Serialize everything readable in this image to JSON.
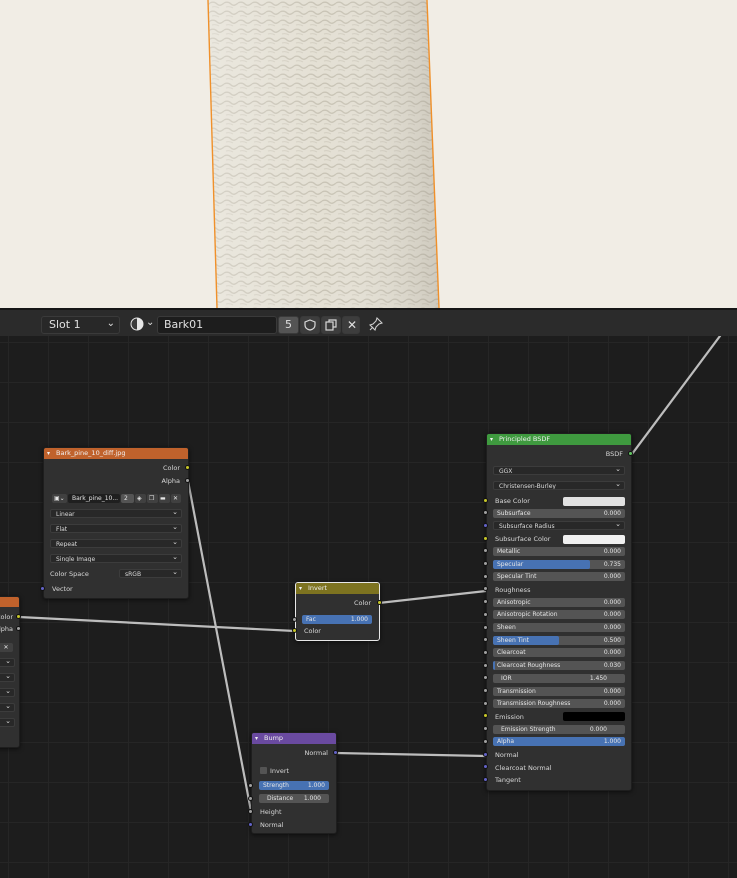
{
  "toolbar": {
    "slot": "Slot 1",
    "material_name": "Bark01",
    "user_count": "5"
  },
  "image_node": {
    "title": "Bark_pine_10_diff.jpg",
    "outputs": [
      "Color",
      "Alpha"
    ],
    "image_name": "Bark_pine_10...",
    "image_users": "2",
    "interpolation": "Linear",
    "projection": "Flat",
    "extension": "Repeat",
    "source": "Single Image",
    "color_space_label": "Color Space",
    "color_space": "sRGB",
    "vector_label": "Vector",
    "header_color": "#c0622c"
  },
  "partial_node": {
    "outputs": [
      "Color",
      "Alpha"
    ]
  },
  "invert_node": {
    "title": "Invert",
    "output": "Color",
    "fac_label": "Fac",
    "fac_value": "1.000",
    "fac_fraction": 1.0,
    "color_label": "Color",
    "header_color": "#7d7320"
  },
  "bump_node": {
    "title": "Bump",
    "output": "Normal",
    "invert_label": "Invert",
    "strength_label": "Strength",
    "strength_value": "1.000",
    "strength_fraction": 1.0,
    "distance_label": "Distance",
    "distance_value": "1.000",
    "height_label": "Height",
    "normal_label": "Normal",
    "header_color": "#6a4aa0"
  },
  "bsdf_node": {
    "title": "Principled BSDF",
    "output": "BSDF",
    "distribution": "GGX",
    "subsurface_method": "Christensen-Burley",
    "header_color": "#3f9a3f",
    "inputs": [
      {
        "label": "Base Color",
        "type": "color",
        "color": "#e2e2e2",
        "socket": "y"
      },
      {
        "label": "Subsurface",
        "value": "0.000",
        "fraction": 0,
        "socket": "g"
      },
      {
        "label": "Subsurface Radius",
        "type": "dropdown",
        "socket": "b"
      },
      {
        "label": "Subsurface Color",
        "type": "color",
        "color": "#f0f0f0",
        "socket": "y"
      },
      {
        "label": "Metallic",
        "value": "0.000",
        "fraction": 0,
        "socket": "g"
      },
      {
        "label": "Specular",
        "value": "0.735",
        "fraction": 0.735,
        "socket": "g"
      },
      {
        "label": "Specular Tint",
        "value": "0.000",
        "fraction": 0,
        "socket": "g"
      },
      {
        "label": "Roughness",
        "type": "plain",
        "socket": "g"
      },
      {
        "label": "Anisotropic",
        "value": "0.000",
        "fraction": 0,
        "socket": "g"
      },
      {
        "label": "Anisotropic Rotation",
        "value": "0.000",
        "fraction": 0,
        "socket": "g"
      },
      {
        "label": "Sheen",
        "value": "0.000",
        "fraction": 0,
        "socket": "g"
      },
      {
        "label": "Sheen Tint",
        "value": "0.500",
        "fraction": 0.5,
        "socket": "g"
      },
      {
        "label": "Clearcoat",
        "value": "0.000",
        "fraction": 0,
        "socket": "g"
      },
      {
        "label": "Clearcoat Roughness",
        "value": "0.030",
        "fraction": 0.03,
        "socket": "g"
      },
      {
        "label": "IOR",
        "value": "1.450",
        "type": "center",
        "socket": "g"
      },
      {
        "label": "Transmission",
        "value": "0.000",
        "fraction": 0,
        "socket": "g"
      },
      {
        "label": "Transmission Roughness",
        "value": "0.000",
        "fraction": 0,
        "socket": "g"
      },
      {
        "label": "Emission",
        "type": "color",
        "color": "#000000",
        "socket": "y"
      },
      {
        "label": "Emission Strength",
        "value": "0.000",
        "type": "center",
        "socket": "g"
      },
      {
        "label": "Alpha",
        "value": "1.000",
        "fraction": 1.0,
        "socket": "g"
      },
      {
        "label": "Normal",
        "type": "plain",
        "socket": "b"
      },
      {
        "label": "Clearcoat Normal",
        "type": "plain",
        "socket": "b"
      },
      {
        "label": "Tangent",
        "type": "plain",
        "socket": "b"
      }
    ]
  }
}
